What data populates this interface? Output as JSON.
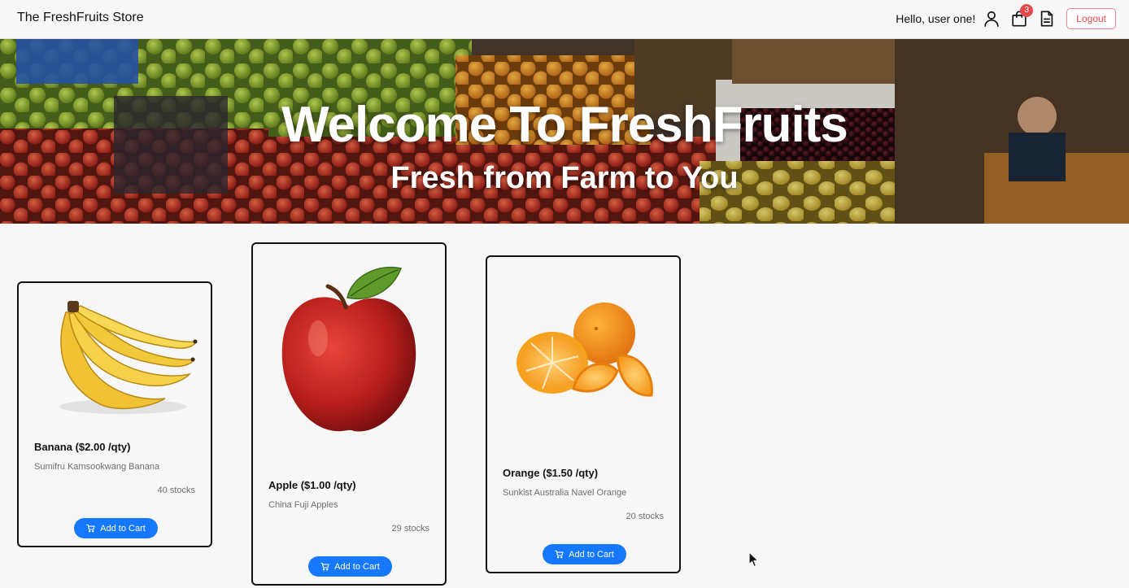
{
  "navbar": {
    "brand": "The FreshFruits Store",
    "greeting": "Hello, user one!",
    "icons": [
      "user-icon",
      "shopping-bag-icon",
      "document-icon"
    ],
    "cart_count": "3",
    "logout_label": "Logout"
  },
  "hero": {
    "title": "Welcome To FreshFruits",
    "subtitle": "Fresh from Farm to You"
  },
  "products": [
    {
      "name": "Banana ($2.00 /qty)",
      "description": "Sumifru Kamsookwang Banana",
      "stock": "40 stocks",
      "button": "Add to Cart",
      "image": "banana"
    },
    {
      "name": "Apple ($1.00 /qty)",
      "description": "China Fuji Apples",
      "stock": "29 stocks",
      "button": "Add to Cart",
      "image": "apple"
    },
    {
      "name": "Orange ($1.50 /qty)",
      "description": "Sunkist Australia Navel Orange",
      "stock": "20 stocks",
      "button": "Add to Cart",
      "image": "orange"
    }
  ],
  "colors": {
    "primary_button": "#1677ff",
    "logout": "#e5484d",
    "badge": "#e5484d",
    "background": "#f7f7f7"
  }
}
